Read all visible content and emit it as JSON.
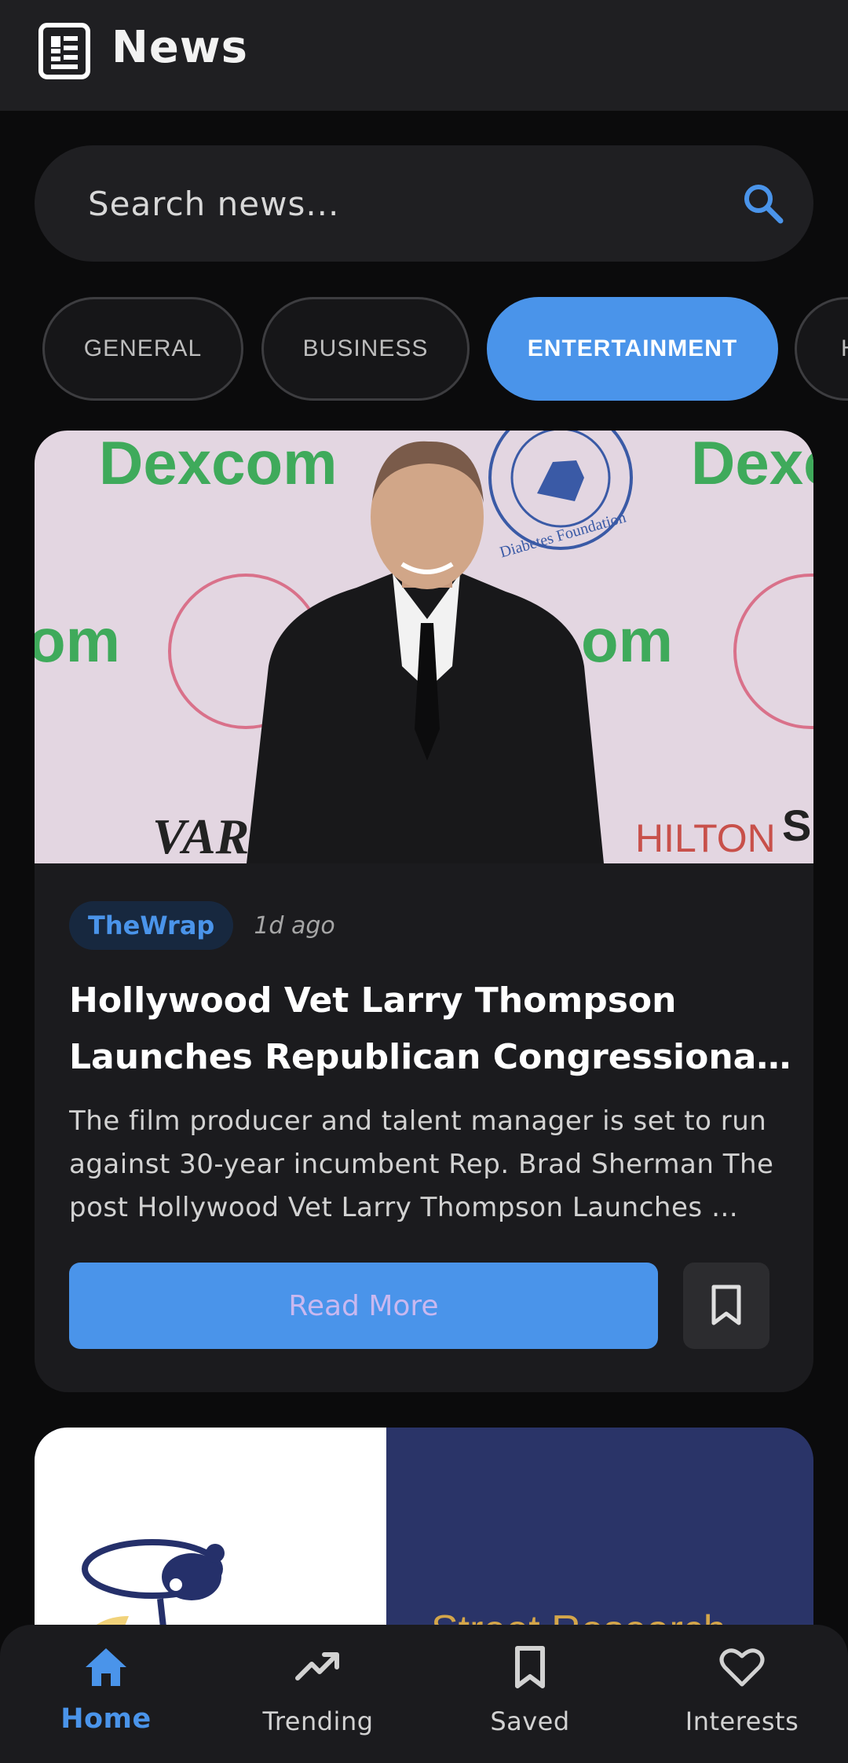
{
  "app": {
    "title": "News",
    "accent_color": "#4a94ea"
  },
  "search": {
    "placeholder": "Search news...",
    "icon": "search-icon"
  },
  "categories": {
    "items": [
      {
        "label": "GENERAL",
        "active": false
      },
      {
        "label": "BUSINESS",
        "active": false
      },
      {
        "label": "ENTERTAINMENT",
        "active": true
      },
      {
        "label": "H",
        "active": false
      }
    ]
  },
  "articles": [
    {
      "image_backdrop": {
        "sponsor_word": "Dexcom",
        "partial_word": "om",
        "seal_text": "Diabetes Foundation",
        "bottom_left": "VAR",
        "bottom_right": "HILTON",
        "partial_mark": "S"
      },
      "source": "TheWrap",
      "time": "1d ago",
      "headline": "Hollywood Vet Larry Thompson Launches Republican Congressional Campaign in …",
      "summary": "The film producer and talent manager is set to run against 30-year incumbent Rep. Brad Sherman The post Hollywood Vet Larry Thompson Launches …",
      "read_more_label": "Read More",
      "bookmark_icon": "bookmark-icon"
    },
    {
      "promo_text": "Street Research"
    }
  ],
  "bottom_nav": {
    "items": [
      {
        "label": "Home",
        "icon": "home-icon",
        "active": true
      },
      {
        "label": "Trending",
        "icon": "trending-icon",
        "active": false
      },
      {
        "label": "Saved",
        "icon": "bookmark-icon",
        "active": false
      },
      {
        "label": "Interests",
        "icon": "heart-icon",
        "active": false
      }
    ]
  }
}
